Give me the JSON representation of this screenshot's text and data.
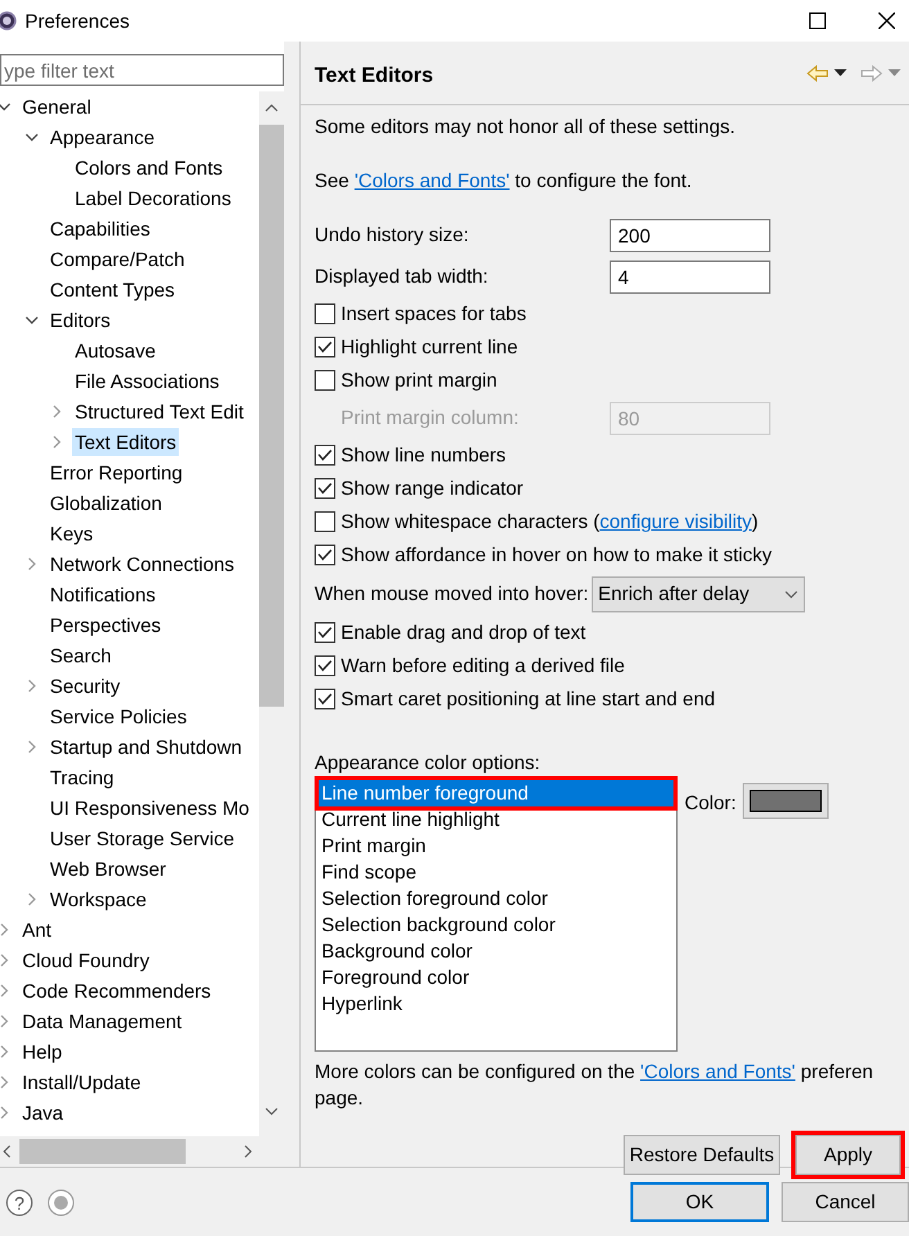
{
  "window": {
    "title": "Preferences"
  },
  "filter": {
    "placeholder": "ype filter text"
  },
  "tree": [
    {
      "label": "General",
      "selected": false,
      "expanded": true,
      "children": [
        {
          "label": "Appearance",
          "selected": false,
          "expanded": true,
          "children": [
            {
              "label": "Colors and Fonts",
              "selected": false
            },
            {
              "label": "Label Decorations",
              "selected": false
            }
          ]
        },
        {
          "label": "Capabilities",
          "selected": false
        },
        {
          "label": "Compare/Patch",
          "selected": false
        },
        {
          "label": "Content Types",
          "selected": false
        },
        {
          "label": "Editors",
          "selected": false,
          "expanded": true,
          "children": [
            {
              "label": "Autosave",
              "selected": false
            },
            {
              "label": "File Associations",
              "selected": false
            },
            {
              "label": "Structured Text Edit",
              "selected": false,
              "expanded": false
            },
            {
              "label": "Text Editors",
              "selected": true,
              "expanded": false
            }
          ]
        },
        {
          "label": "Error Reporting",
          "selected": false
        },
        {
          "label": "Globalization",
          "selected": false
        },
        {
          "label": "Keys",
          "selected": false
        },
        {
          "label": "Network Connections",
          "selected": false,
          "expanded": false
        },
        {
          "label": "Notifications",
          "selected": false
        },
        {
          "label": "Perspectives",
          "selected": false
        },
        {
          "label": "Search",
          "selected": false
        },
        {
          "label": "Security",
          "selected": false,
          "expanded": false
        },
        {
          "label": "Service Policies",
          "selected": false
        },
        {
          "label": "Startup and Shutdown",
          "selected": false,
          "expanded": false
        },
        {
          "label": "Tracing",
          "selected": false
        },
        {
          "label": "UI Responsiveness Mo",
          "selected": false
        },
        {
          "label": "User Storage Service",
          "selected": false
        },
        {
          "label": "Web Browser",
          "selected": false
        },
        {
          "label": "Workspace",
          "selected": false,
          "expanded": false
        }
      ]
    },
    {
      "label": "Ant",
      "selected": false,
      "expanded": false
    },
    {
      "label": "Cloud Foundry",
      "selected": false,
      "expanded": false
    },
    {
      "label": "Code Recommenders",
      "selected": false,
      "expanded": false
    },
    {
      "label": "Data Management",
      "selected": false,
      "expanded": false
    },
    {
      "label": "Help",
      "selected": false,
      "expanded": false
    },
    {
      "label": "Install/Update",
      "selected": false,
      "expanded": false
    },
    {
      "label": "Java",
      "selected": false,
      "expanded": false
    }
  ],
  "page": {
    "title": "Text Editors",
    "intro": "Some editors may not honor all of these settings.",
    "see": {
      "before": "See ",
      "link": "'Colors and Fonts'",
      "after": " to configure the font."
    },
    "settings": [
      {
        "kind": "field",
        "label": "Undo history size:",
        "value": "200",
        "disabled": false
      },
      {
        "kind": "field",
        "label": "Displayed tab width:",
        "value": "4",
        "disabled": false
      },
      {
        "kind": "checkbox",
        "label": "Insert spaces for tabs",
        "checked": false
      },
      {
        "kind": "checkbox",
        "label": "Highlight current line",
        "checked": true
      },
      {
        "kind": "checkbox",
        "label": "Show print margin",
        "checked": false
      },
      {
        "kind": "field",
        "label": "Print margin column:",
        "value": "80",
        "disabled": true
      },
      {
        "kind": "checkbox",
        "label": "Show line numbers",
        "checked": true
      },
      {
        "kind": "checkbox",
        "label": "Show range indicator",
        "checked": true
      },
      {
        "kind": "checkbox",
        "label": "Show whitespace characters (",
        "link": "configure visibility",
        "after": ")",
        "checked": false
      },
      {
        "kind": "checkbox",
        "label": "Show affordance in hover on how to make it sticky",
        "checked": true
      },
      {
        "kind": "select",
        "label": "When mouse moved into hover:",
        "value": "Enrich after delay"
      },
      {
        "kind": "checkbox",
        "label": "Enable drag and drop of text",
        "checked": true
      },
      {
        "kind": "checkbox",
        "label": "Warn before editing a derived file",
        "checked": true
      },
      {
        "kind": "checkbox",
        "label": "Smart caret positioning at line start and end",
        "checked": true
      }
    ],
    "colors_label": "Appearance color options:",
    "color_options": [
      {
        "label": "Line number foreground",
        "selected": true,
        "highlighted": true
      },
      {
        "label": "Current line highlight",
        "selected": false,
        "highlighted": false
      },
      {
        "label": "Print margin",
        "selected": false,
        "highlighted": false
      },
      {
        "label": "Find scope",
        "selected": false,
        "highlighted": false
      },
      {
        "label": "Selection foreground color",
        "selected": false,
        "highlighted": false
      },
      {
        "label": "Selection background color",
        "selected": false,
        "highlighted": false
      },
      {
        "label": "Background color",
        "selected": false,
        "highlighted": false
      },
      {
        "label": "Foreground color",
        "selected": false,
        "highlighted": false
      },
      {
        "label": "Hyperlink",
        "selected": false,
        "highlighted": false
      }
    ],
    "color_label": "Color:",
    "color": "#707070",
    "more": {
      "before": "More colors can be configured on the ",
      "link": "'Colors and Fonts'",
      "after": " preferen",
      "line2": "page."
    },
    "buttons": [
      {
        "label": "Restore Defaults",
        "highlighted": false
      },
      {
        "label": "Apply",
        "highlighted": true
      }
    ]
  },
  "footer": {
    "help": "?",
    "buttons": [
      {
        "label": "OK",
        "default": true
      },
      {
        "label": "Cancel",
        "default": false
      }
    ]
  }
}
